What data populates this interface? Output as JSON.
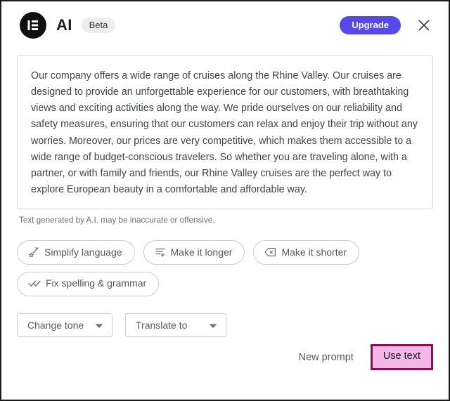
{
  "dialog": {
    "header": {
      "logo_icon": "elementor-logo-icon",
      "title": "AI",
      "badge": "Beta",
      "upgrade_label": "Upgrade",
      "close_icon": "close-icon",
      "upgrade_color": "#5649e8"
    },
    "content": {
      "generated_text": "Our company offers a wide range of cruises along the Rhine Valley. Our cruises are designed to provide an unforgettable experience for our customers, with breathtaking views and exciting activities along the way. We pride ourselves on our reliability and safety measures, ensuring that our customers can relax and enjoy their trip without any worries. Moreover, our prices are very competitive, which makes them accessible to a wide range of budget-conscious travelers. So whether you are traveling alone, with a partner, or with family and friends, our Rhine Valley cruises are the perfect way to explore European beauty in a comfortable and affordable way.",
      "disclaimer": "Text generated by A.I. may be inaccurate or offensive."
    },
    "chips": [
      {
        "label": "Simplify language",
        "icon": "magic-wand-icon"
      },
      {
        "label": "Make it longer",
        "icon": "list-plus-icon"
      },
      {
        "label": "Make it shorter",
        "icon": "backspace-icon"
      },
      {
        "label": "Fix spelling & grammar",
        "icon": "double-check-icon"
      }
    ],
    "selects": [
      {
        "label": "Change tone",
        "icon": "chevron-down-icon"
      },
      {
        "label": "Translate to",
        "icon": "chevron-down-icon"
      }
    ],
    "footer": {
      "new_prompt_label": "New prompt",
      "use_text_label": "Use text",
      "use_text_border_color": "#8d0f52",
      "use_text_background_color": "#f3b7e8"
    }
  }
}
